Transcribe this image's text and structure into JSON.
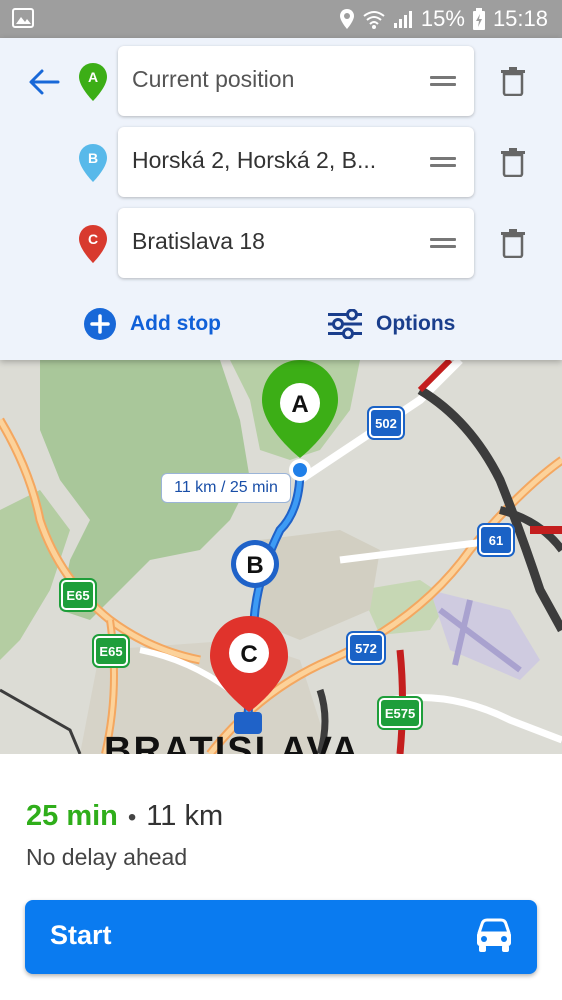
{
  "status_bar": {
    "battery": "15%",
    "time": "15:18",
    "icons": [
      "image-icon",
      "location-icon",
      "wifi-icon",
      "signal-icon",
      "battery-icon"
    ]
  },
  "waypoints": [
    {
      "letter": "A",
      "placeholder": "Current position",
      "value": "",
      "pin_color": "#3cae16"
    },
    {
      "letter": "B",
      "placeholder": "",
      "value": "Horská 2, Horská 2, B...",
      "pin_color": "#58b9ea"
    },
    {
      "letter": "C",
      "placeholder": "",
      "value": "Bratislava 18",
      "pin_color": "#d83a2e"
    }
  ],
  "actions": {
    "add_stop": "Add stop",
    "options": "Options"
  },
  "map": {
    "route_label": "11 km / 25 min",
    "city_label": "BRATISLAVA",
    "markers": [
      "A",
      "B",
      "C"
    ],
    "shields": [
      {
        "text": "502",
        "kind": "blue"
      },
      {
        "text": "61",
        "kind": "blue"
      },
      {
        "text": "572",
        "kind": "blue"
      },
      {
        "text": "E65",
        "kind": "green"
      },
      {
        "text": "E65",
        "kind": "green"
      },
      {
        "text": "E575",
        "kind": "green"
      }
    ]
  },
  "summary": {
    "duration": "25 min",
    "separator": "•",
    "distance": "11 km",
    "delay": "No delay ahead"
  },
  "start_button": {
    "label": "Start"
  },
  "colors": {
    "accent": "#0a7bf0",
    "duration_green": "#2fae1a",
    "route_blue": "#1f7fe8"
  }
}
